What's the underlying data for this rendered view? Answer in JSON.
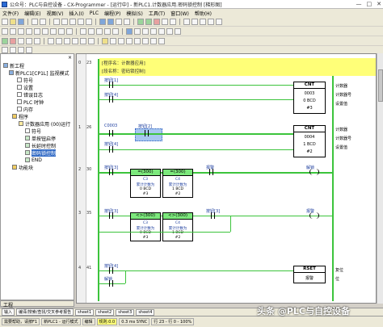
{
  "window": {
    "title": "公众号：PLC与自控设备 - CX-Programmer - [运行中] - 新PLC1.计数器应用.密码锁控制 [梯形图]",
    "minimize": "—",
    "maximize": "□",
    "close": "✕"
  },
  "menu": [
    "文件(F)",
    "编辑(E)",
    "视图(V)",
    "插入(I)",
    "PLC",
    "编程(P)",
    "模拟(S)",
    "工具(T)",
    "窗口(W)",
    "帮助(H)"
  ],
  "tree": {
    "items": [
      {
        "label": "新工程",
        "icon": "project-icon"
      },
      {
        "label": "新PLC1[CP1L] 监视模式",
        "icon": "plc-icon"
      },
      {
        "label": "符号",
        "icon": "symbols-icon"
      },
      {
        "label": "设置",
        "icon": "settings-icon"
      },
      {
        "label": "错误日志",
        "icon": "errorlog-icon"
      },
      {
        "label": "PLC 时钟",
        "icon": "clock-icon"
      },
      {
        "label": "内存",
        "icon": "memory-icon"
      },
      {
        "label": "程序",
        "icon": "folder-icon"
      },
      {
        "label": "计数器应用 (00)运行",
        "icon": "task-icon"
      },
      {
        "label": "符号",
        "icon": "symbols-icon"
      },
      {
        "label": "单按钮启停",
        "icon": "section-icon"
      },
      {
        "label": "长延时控制",
        "icon": "section-icon"
      },
      {
        "label": "密码锁控制",
        "icon": "section-icon"
      },
      {
        "label": "END",
        "icon": "section-icon"
      },
      {
        "label": "功能块",
        "icon": "function-block-icon"
      }
    ],
    "footer": "工程"
  },
  "ladder": {
    "comment_title": "[程序名：计数器应用]",
    "comment_section": "[段名称：密码锁控制]",
    "rungs": [
      {
        "num": "0",
        "step": "23"
      },
      {
        "num": "1",
        "step": "26"
      },
      {
        "num": "2",
        "step": "30"
      },
      {
        "num": "3",
        "step": "35"
      },
      {
        "num": "4",
        "step": "41"
      }
    ],
    "rung0": {
      "contact1": "按钮[1]",
      "contact2": "按钮[4]",
      "inst": "CNT",
      "op1": "0003",
      "op2": "0 BCD",
      "op3": "#3",
      "side": [
        "计数器",
        "计数器号",
        "设置值"
      ]
    },
    "rung1": {
      "contact1": "C0003",
      "contact2": "按钮[2]",
      "contact3": "按钮[4]",
      "inst": "CNT",
      "op1": "0004",
      "op2": "1 BCD",
      "op3": "#2",
      "side": [
        "计数器",
        "计数器号",
        "设置值"
      ]
    },
    "rung2": {
      "contact": "按钮[3]",
      "cmp1": {
        "h": "=(300)",
        "l1": "C3",
        "l2": "累计计数为",
        "v": "0 BCD",
        "c": "#3"
      },
      "cmp2": {
        "h": "=(300)",
        "l1": "C4",
        "l2": "累计计数为",
        "v": "1 BCD",
        "c": "#2"
      },
      "coil_label": "报警",
      "out": "解锁"
    },
    "rung3": {
      "contact": "按钮[3]",
      "cmp1": {
        "h": "<>(300)",
        "l1": "C3",
        "l2": "累计计数为",
        "v": "0 BCD",
        "c": "#3"
      },
      "cmp2": {
        "h": "<>(300)",
        "l1": "C4",
        "l2": "累计计数为",
        "v": "1 BCD",
        "c": "#2"
      },
      "contact2": "按钮[3]",
      "out": "报警"
    },
    "rung4": {
      "contact1": "按钮[4]",
      "contact2": "解锁",
      "inst": "RSET",
      "op1": "报警",
      "side": [
        "复位",
        "位"
      ]
    }
  },
  "tabs": [
    "输入",
    "编译/搜索/查找/交叉参考报告",
    "sheet1",
    "sheet2",
    "sheet3",
    "sheet4"
  ],
  "status": [
    "需要帮助，请按F1",
    "新PLC1 - 运行模式",
    "编辑",
    "规则:0.0",
    "0.3 ms SYNC",
    "行 23 - 行 0 - 100%"
  ],
  "watermark": "头条 @PLC与自控设备"
}
